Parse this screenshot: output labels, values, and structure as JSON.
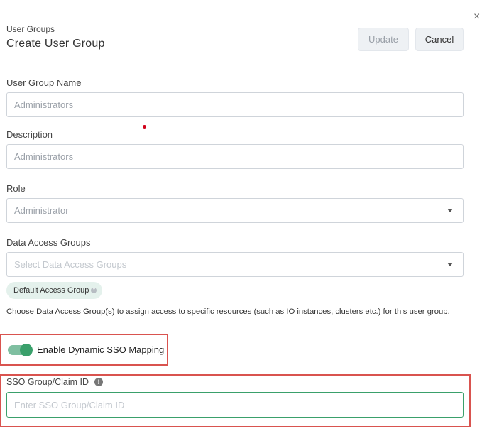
{
  "header": {
    "breadcrumb": "User Groups",
    "title": "Create User Group",
    "update_label": "Update",
    "cancel_label": "Cancel",
    "close_glyph": "×"
  },
  "form": {
    "name": {
      "label": "User Group Name",
      "value": "Administrators"
    },
    "description": {
      "label": "Description",
      "value": "Administrators"
    },
    "role": {
      "label": "Role",
      "value": "Administrator"
    },
    "data_access": {
      "label": "Data Access Groups",
      "placeholder": "Select Data Access Groups",
      "selected_chip": "Default Access Group",
      "help": "Choose Data Access Group(s) to assign access to specific resources (such as IO instances, clusters etc.) for this user group."
    },
    "dynamic_sso": {
      "label": "Enable Dynamic SSO Mapping",
      "enabled": true
    },
    "sso_group": {
      "label": "SSO Group/Claim ID",
      "placeholder": "Enter SSO Group/Claim ID",
      "info_glyph": "!"
    }
  },
  "colors": {
    "accent_green": "#3aa06b",
    "highlight_red": "#d9534f",
    "chip_bg": "#e4f1ec"
  }
}
